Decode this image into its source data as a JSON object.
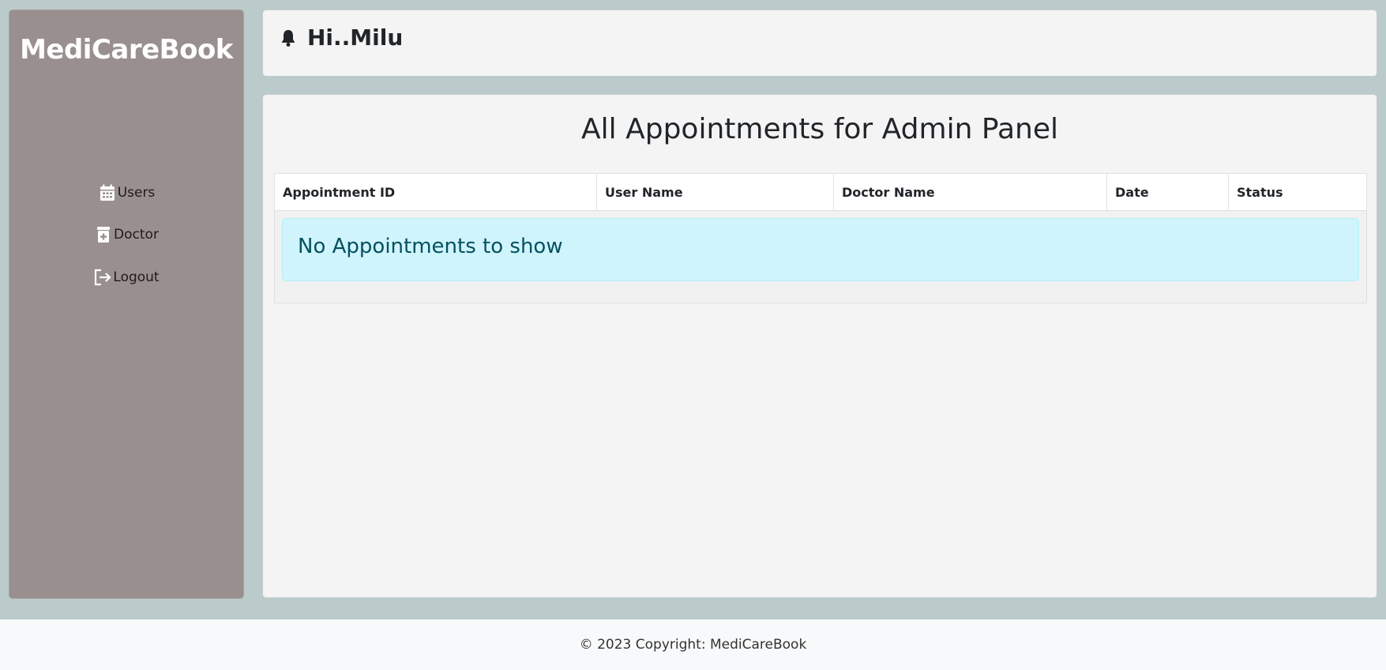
{
  "brand": {
    "name": "MediCareBook"
  },
  "sidebar": {
    "items": [
      {
        "label": "Users",
        "icon": "calendar-icon"
      },
      {
        "label": "Doctor",
        "icon": "medical-case-icon"
      },
      {
        "label": "Logout",
        "icon": "logout-icon"
      }
    ]
  },
  "header": {
    "greeting": "Hi..Milu",
    "icon": "bell-icon"
  },
  "main": {
    "title": "All Appointments for Admin Panel",
    "table": {
      "columns": [
        "Appointment ID",
        "User Name",
        "Doctor Name",
        "Date",
        "Status"
      ],
      "rows": [],
      "empty_message": "No Appointments to show"
    }
  },
  "footer": {
    "text": "© 2023 Copyright: MediCareBook"
  },
  "colors": {
    "page_bg": "#bbcaca",
    "sidebar_bg": "#9a8f8f",
    "card_bg": "#f4f4f4",
    "alert_bg": "#cff4fc",
    "alert_text": "#055160"
  }
}
